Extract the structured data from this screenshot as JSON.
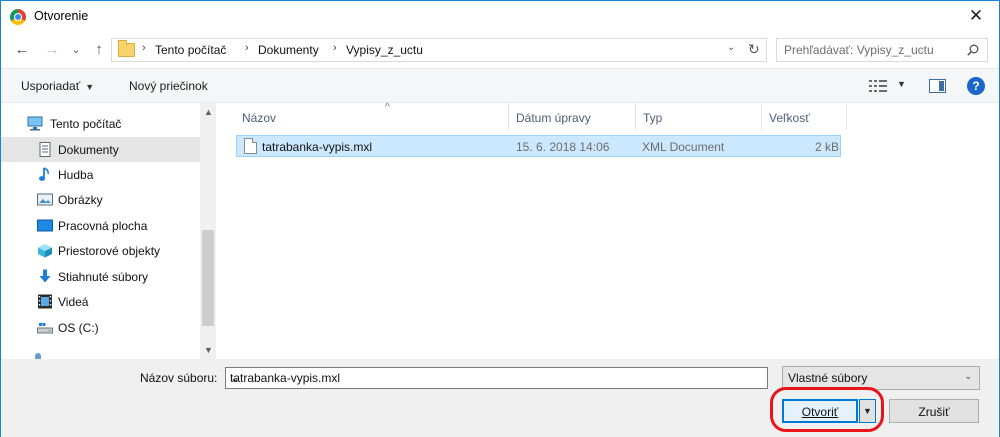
{
  "window": {
    "title": "Otvorenie",
    "close_glyph": "✕"
  },
  "nav": {
    "back_glyph": "←",
    "forward_glyph": "→",
    "recent_glyph": "⌄",
    "up_glyph": "↑",
    "breadcrumb": [
      "Tento počítač",
      "Dokumenty",
      "Vypisy_z_uctu"
    ],
    "crumb_sep": "›",
    "dropdown_glyph": "⌄",
    "refresh_glyph": "↻",
    "search_placeholder": "Prehľadávať: Vypisy_z_uctu"
  },
  "toolbar": {
    "organize_label": "Usporiadať",
    "organize_arrow": "▼",
    "new_folder_label": "Nový priečinok",
    "view_dd_glyph": "▼",
    "help_glyph": "?"
  },
  "sidebar": {
    "items": [
      {
        "label": "Tento počítač",
        "icon": "computer-icon"
      },
      {
        "label": "Dokumenty",
        "icon": "documents-icon"
      },
      {
        "label": "Hudba",
        "icon": "music-icon"
      },
      {
        "label": "Obrázky",
        "icon": "pictures-icon"
      },
      {
        "label": "Pracovná plocha",
        "icon": "desktop-icon"
      },
      {
        "label": "Priestorové objekty",
        "icon": "3d-objects-icon"
      },
      {
        "label": "Stiahnuté súbory",
        "icon": "downloads-icon"
      },
      {
        "label": "Videá",
        "icon": "videos-icon"
      },
      {
        "label": "OS (C:)",
        "icon": "drive-icon"
      }
    ],
    "scroll_up": "▲",
    "scroll_down": "▼"
  },
  "filelist": {
    "columns": [
      "Názov",
      "Dátum úpravy",
      "Typ",
      "Veľkosť"
    ],
    "sort_glyph": "^",
    "files": [
      {
        "name": "tatrabanka-vypis.mxl",
        "modified": "15. 6. 2018 14:06",
        "type": "XML Document",
        "size": "2 kB"
      }
    ]
  },
  "footer": {
    "filename_label": "Názov súboru:",
    "filename_value": "tatrabanka-vypis.mxl",
    "filename_dd": "⌄",
    "filter_value": "Vlastné súbory",
    "filter_dd": "⌄",
    "open_label": "Otvoriť",
    "open_split_glyph": "▼",
    "cancel_label": "Zrušiť"
  },
  "colors": {
    "accent": "#0078d7",
    "selection": "#cce8ff",
    "highlight_ring": "#e8141b"
  }
}
